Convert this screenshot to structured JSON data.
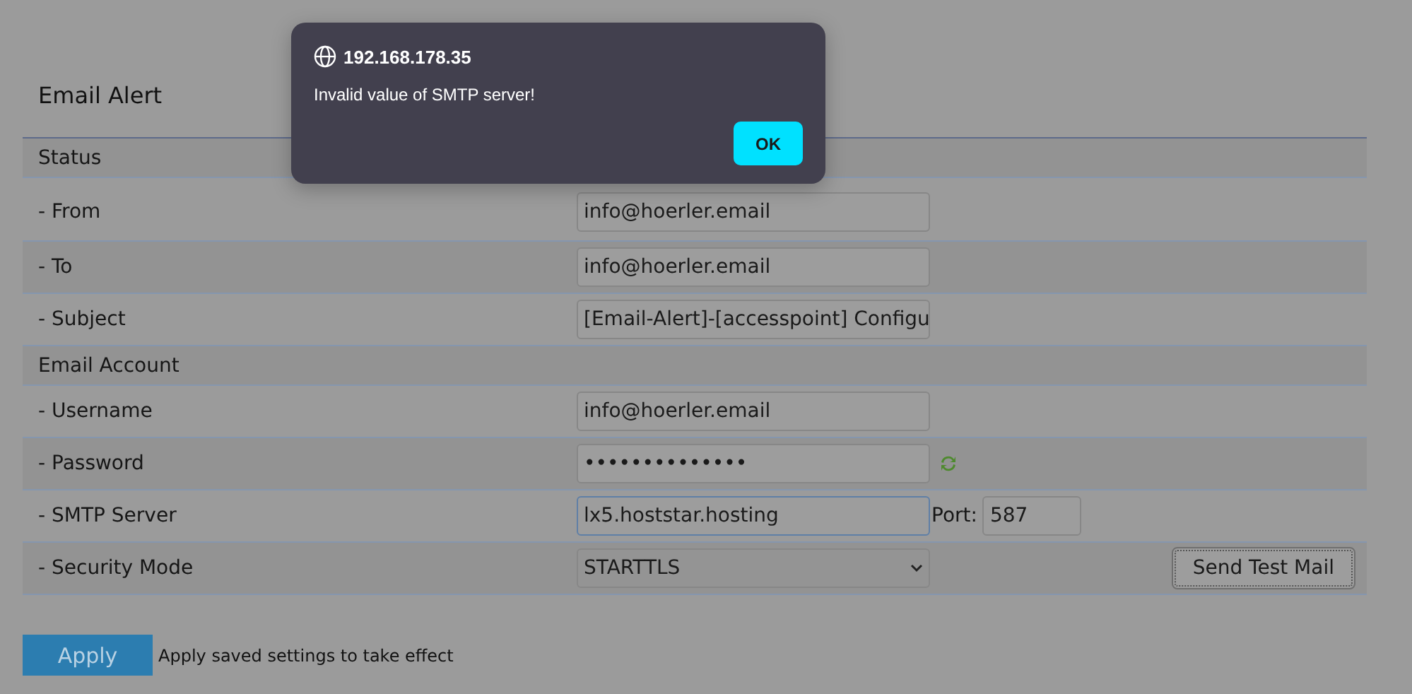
{
  "page": {
    "title": "Email Alert"
  },
  "rows": [
    {
      "kind": "section",
      "label": "Status"
    },
    {
      "kind": "text",
      "label": "- From",
      "value": "info@hoerler.email"
    },
    {
      "kind": "text",
      "label": "- To",
      "value": "info@hoerler.email"
    },
    {
      "kind": "text",
      "label": "- Subject",
      "value": "[Email-Alert]-[accesspoint] Configu"
    },
    {
      "kind": "section",
      "label": "Email Account"
    },
    {
      "kind": "text",
      "label": "- Username",
      "value": "info@hoerler.email"
    },
    {
      "kind": "password",
      "label": "- Password",
      "value": "••••••••••••••"
    },
    {
      "kind": "server",
      "label": "- SMTP Server",
      "value": "lx5.hoststar.hosting",
      "focused": true,
      "port_label": "Port:",
      "port": "587"
    },
    {
      "kind": "select",
      "label": "- Security Mode",
      "value": "STARTTLS",
      "button": "Send Test Mail"
    }
  ],
  "apply": {
    "button": "Apply",
    "note": "Apply saved settings to take effect"
  },
  "dialog": {
    "origin": "192.168.178.35",
    "message": "Invalid value of SMTP server!",
    "button": "OK"
  }
}
